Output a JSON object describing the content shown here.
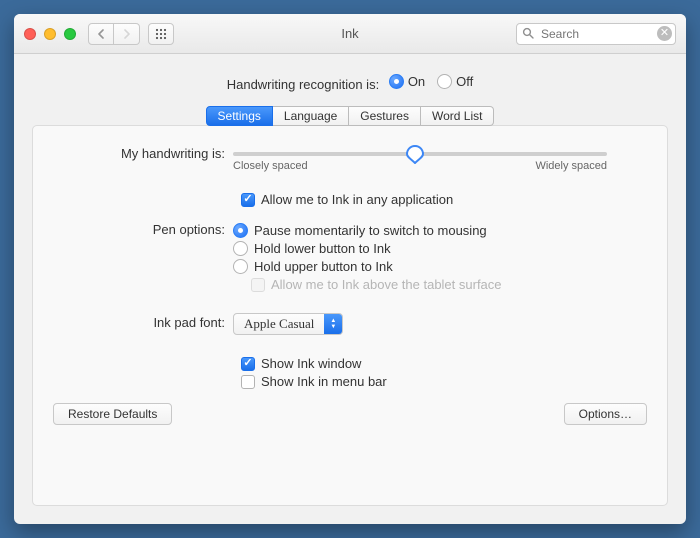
{
  "window": {
    "title": "Ink"
  },
  "toolbar": {
    "search_placeholder": "Search"
  },
  "recognition": {
    "label": "Handwriting recognition is:",
    "options": {
      "on": "On",
      "off": "Off"
    },
    "selected": "on"
  },
  "tabs": {
    "settings": "Settings",
    "language": "Language",
    "gestures": "Gestures",
    "wordlist": "Word List",
    "active": "settings"
  },
  "settings": {
    "handwriting_label": "My handwriting is:",
    "slider": {
      "min_label": "Closely spaced",
      "max_label": "Widely spaced"
    },
    "allow_any_app": {
      "label": "Allow me to Ink in any application",
      "checked": true
    },
    "pen_options": {
      "label": "Pen options:",
      "choices": {
        "pause": "Pause momentarily to switch to mousing",
        "lower": "Hold lower button to Ink",
        "upper": "Hold upper button to Ink"
      },
      "selected": "pause",
      "above_surface": {
        "label": "Allow me to Ink above the tablet surface",
        "checked": false,
        "enabled": false
      }
    },
    "font": {
      "label": "Ink pad font:",
      "value": "Apple Casual"
    },
    "show_window": {
      "label": "Show Ink window",
      "checked": true
    },
    "show_menubar": {
      "label": "Show Ink in menu bar",
      "checked": false
    }
  },
  "footer": {
    "restore": "Restore Defaults",
    "options": "Options…"
  }
}
